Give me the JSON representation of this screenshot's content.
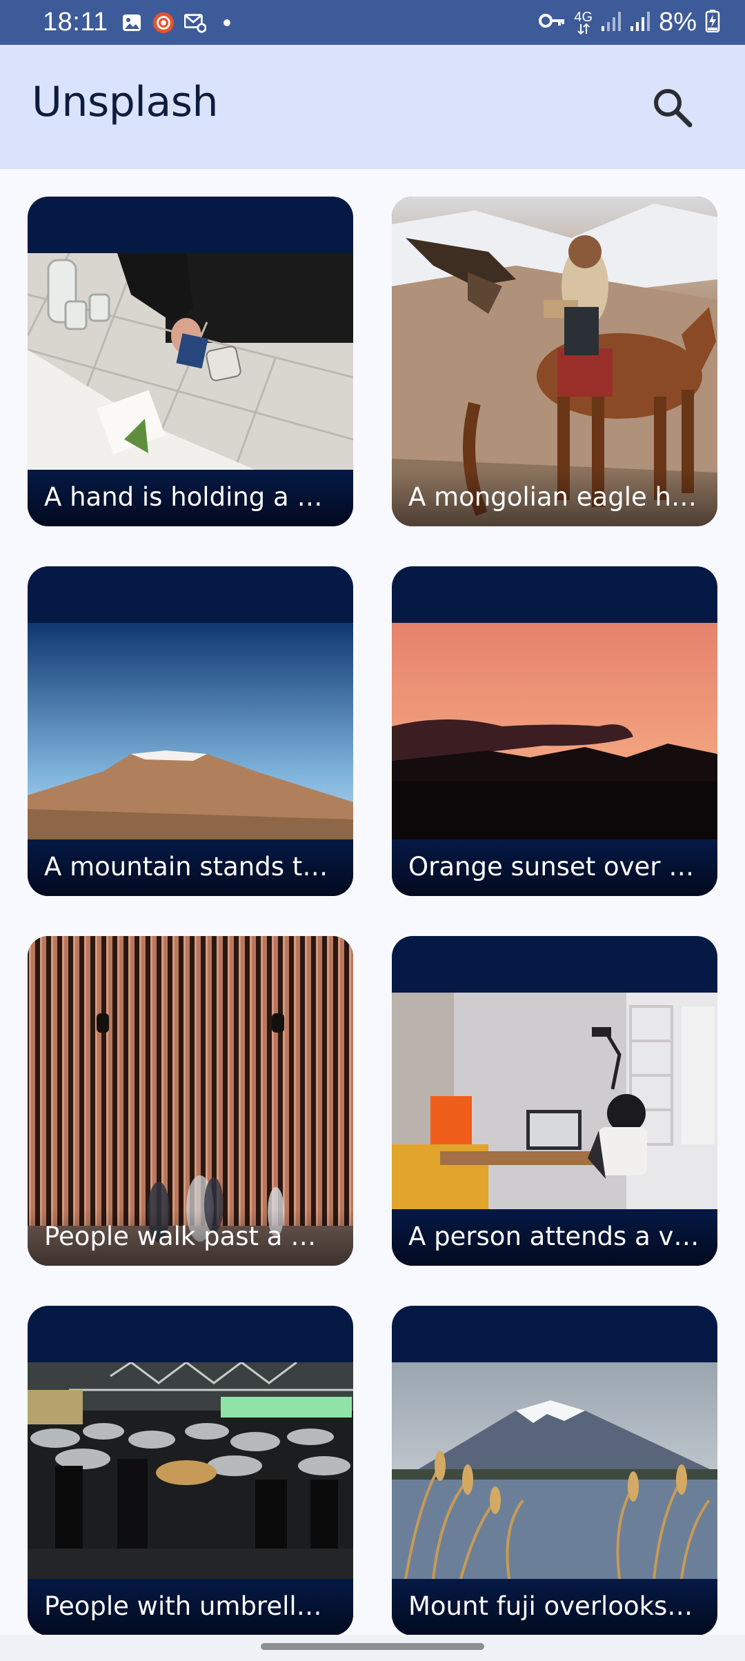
{
  "status_bar": {
    "time": "18:11",
    "network": "4G",
    "battery": "8%",
    "icons_left": [
      "gallery-icon",
      "screen-recorder-icon",
      "mail-settings-icon",
      "dot-icon"
    ],
    "icons_right": [
      "vpn-key-icon",
      "mobile-data-icon",
      "signal-icon",
      "signal-icon",
      "battery-charging-icon"
    ]
  },
  "app_bar": {
    "title": "Unsplash",
    "search_icon": "search-icon"
  },
  "photos": [
    {
      "caption": "A hand is holding a bl…"
    },
    {
      "caption": "A mongolian eagle hu…"
    },
    {
      "caption": "A mountain stands tal…"
    },
    {
      "caption": "Orange sunset over d…"
    },
    {
      "caption": "People walk past a wo…"
    },
    {
      "caption": "A person attends a vir…"
    },
    {
      "caption": "People with umbrella…"
    },
    {
      "caption": "Mount fuji overlooks a…"
    }
  ],
  "colors": {
    "status_bar": "#3d5a99",
    "app_bar": "#dbe2fb",
    "card_background": "#051945",
    "page_background": "#f8f9ff"
  }
}
